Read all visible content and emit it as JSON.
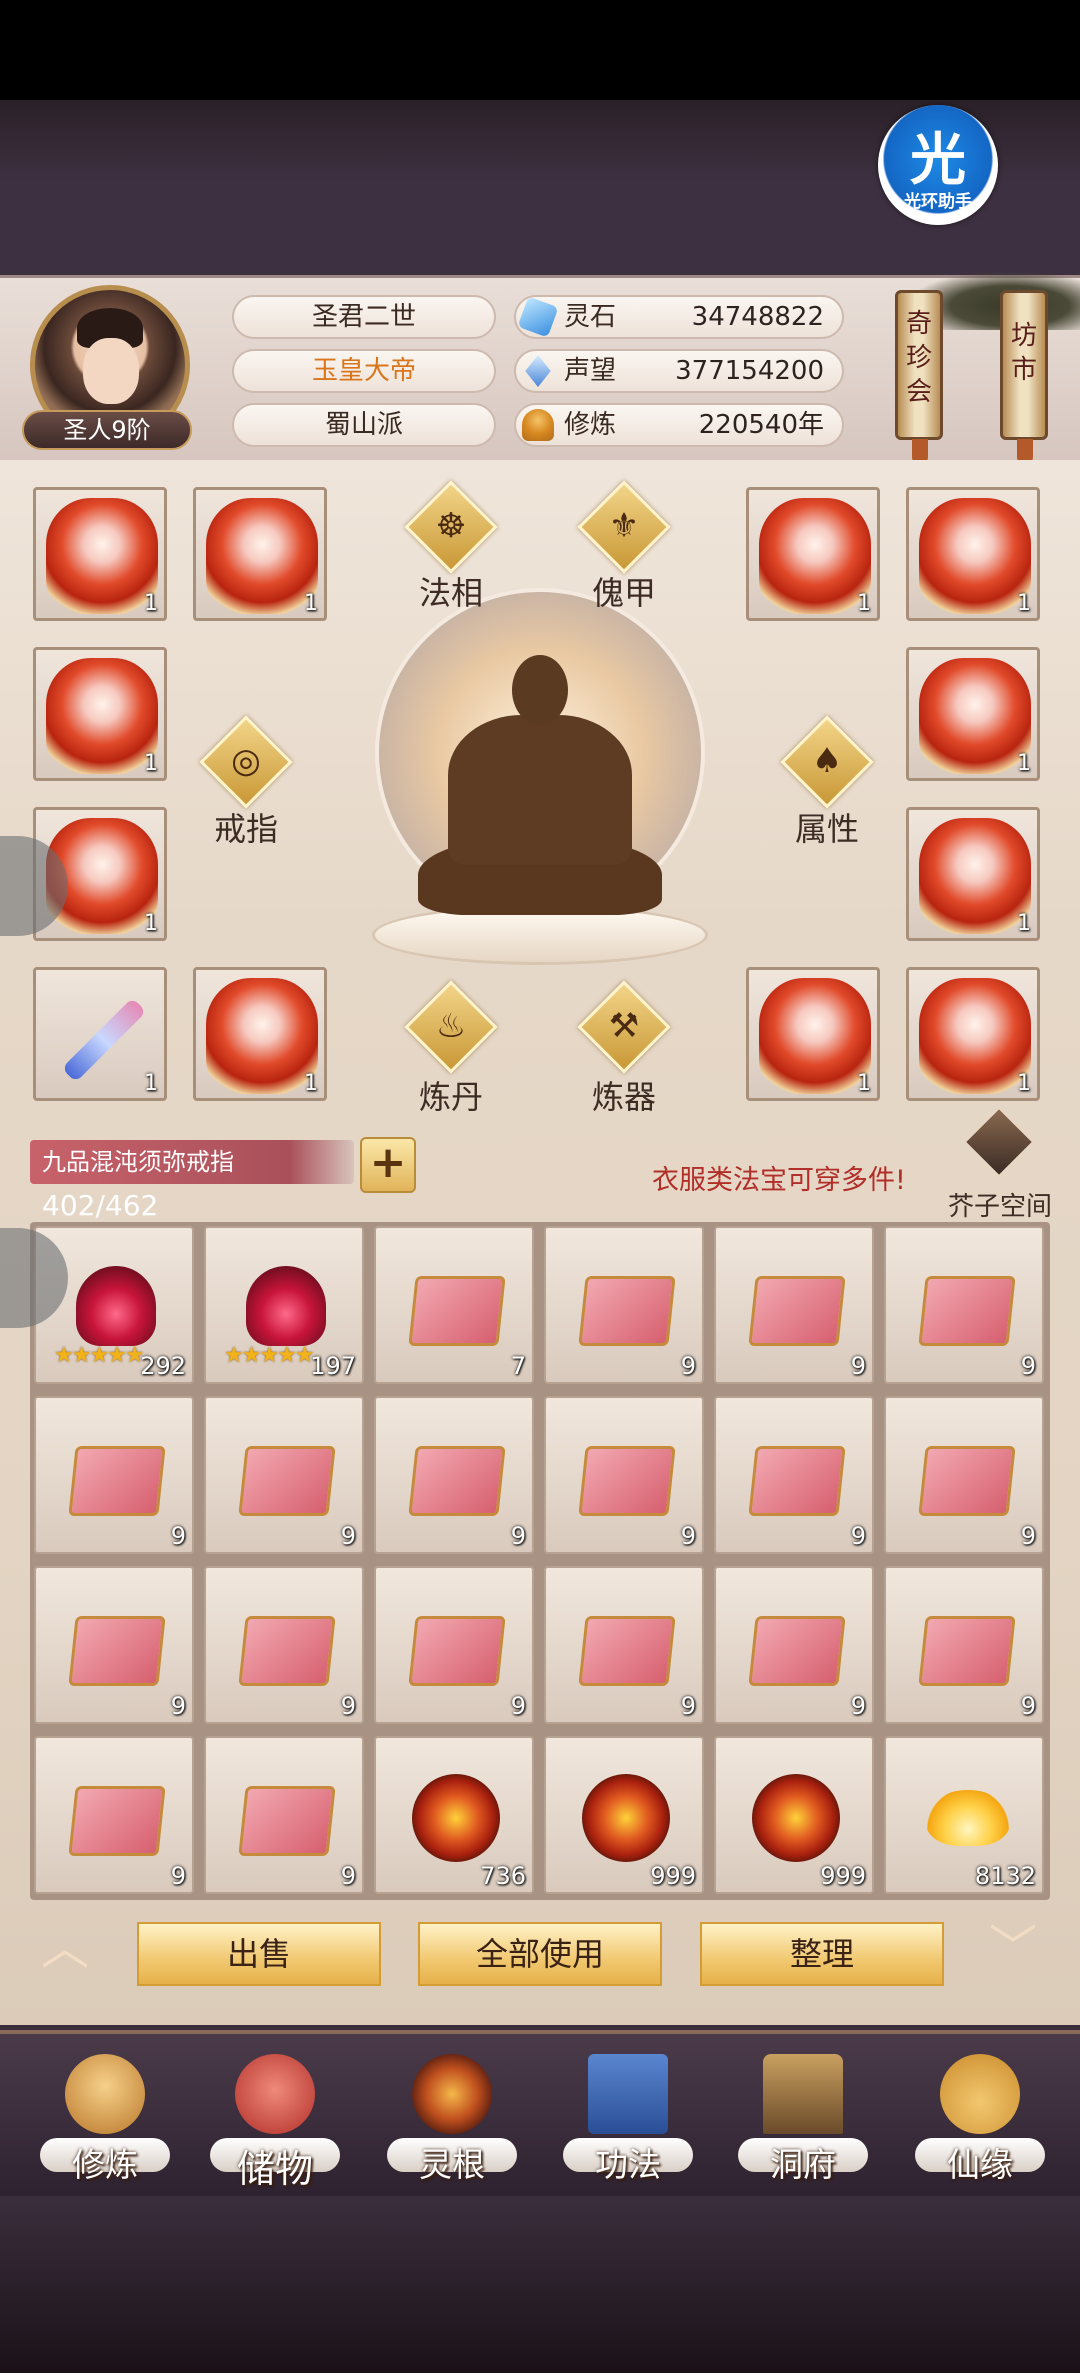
{
  "assistant": {
    "glyph": "光",
    "label": "光环助手"
  },
  "player": {
    "rank": "圣人9阶",
    "title": "圣君二世",
    "honor_title": "玉皇大帝",
    "sect": "蜀山派"
  },
  "stats": [
    {
      "icon": "spirit-stone-icon",
      "label": "灵石",
      "value": "34748822"
    },
    {
      "icon": "prestige-icon",
      "label": "声望",
      "value": "377154200"
    },
    {
      "icon": "cultivation-icon",
      "label": "修炼",
      "value": "220540年"
    }
  ],
  "side_scrolls": [
    "奇珍会",
    "坊市"
  ],
  "equip_slots": {
    "count": "1"
  },
  "diamonds": [
    {
      "label": "法相",
      "glyph": "☸"
    },
    {
      "label": "傀甲",
      "glyph": "⚜"
    },
    {
      "label": "戒指",
      "glyph": "◎"
    },
    {
      "label": "属性",
      "glyph": "♠"
    },
    {
      "label": "炼丹",
      "glyph": "♨"
    },
    {
      "label": "炼器",
      "glyph": "⚒"
    }
  ],
  "storage": {
    "ring_name": "九品混沌须弥戒指",
    "capacity": "402/462",
    "plus": "+"
  },
  "hint": "衣服类法宝可穿多件!",
  "jiezi_label": "芥子空间",
  "inventory": [
    {
      "kind": "flame",
      "count": "292",
      "stars": "★★★★★"
    },
    {
      "kind": "flame",
      "count": "197",
      "stars": "★★★★★"
    },
    {
      "kind": "box",
      "count": "7"
    },
    {
      "kind": "box",
      "count": "9"
    },
    {
      "kind": "box",
      "count": "9"
    },
    {
      "kind": "box",
      "count": "9"
    },
    {
      "kind": "box",
      "count": "9"
    },
    {
      "kind": "box",
      "count": "9"
    },
    {
      "kind": "box",
      "count": "9"
    },
    {
      "kind": "box",
      "count": "9"
    },
    {
      "kind": "box",
      "count": "9"
    },
    {
      "kind": "box",
      "count": "9"
    },
    {
      "kind": "box",
      "count": "9"
    },
    {
      "kind": "box",
      "count": "9"
    },
    {
      "kind": "box",
      "count": "9"
    },
    {
      "kind": "box",
      "count": "9"
    },
    {
      "kind": "box",
      "count": "9"
    },
    {
      "kind": "box",
      "count": "9"
    },
    {
      "kind": "box",
      "count": "9"
    },
    {
      "kind": "box",
      "count": "9"
    },
    {
      "kind": "ring",
      "count": "736"
    },
    {
      "kind": "ring",
      "count": "999"
    },
    {
      "kind": "ring",
      "count": "999"
    },
    {
      "kind": "lotus",
      "count": "8132"
    }
  ],
  "actions": {
    "sell": "出售",
    "use_all": "全部使用",
    "sort": "整理",
    "up": "︿",
    "down": "﹀"
  },
  "nav": [
    {
      "label": "修炼",
      "icon": "cultivate-icon",
      "color": "#d9a04a"
    },
    {
      "label": "储物",
      "icon": "storage-bag-icon",
      "color": "#c8454a"
    },
    {
      "label": "灵根",
      "icon": "spirit-root-icon",
      "color": "#8a3a1a"
    },
    {
      "label": "功法",
      "icon": "scripture-book-icon",
      "color": "#3b66b0"
    },
    {
      "label": "洞府",
      "icon": "cave-palace-icon",
      "color": "#9a6a3a"
    },
    {
      "label": "仙缘",
      "icon": "gourd-icon",
      "color": "#e0a84a"
    }
  ],
  "colors": {
    "accent": "#d9761c",
    "hint": "#b22e28",
    "gold": "#e6b14a"
  }
}
